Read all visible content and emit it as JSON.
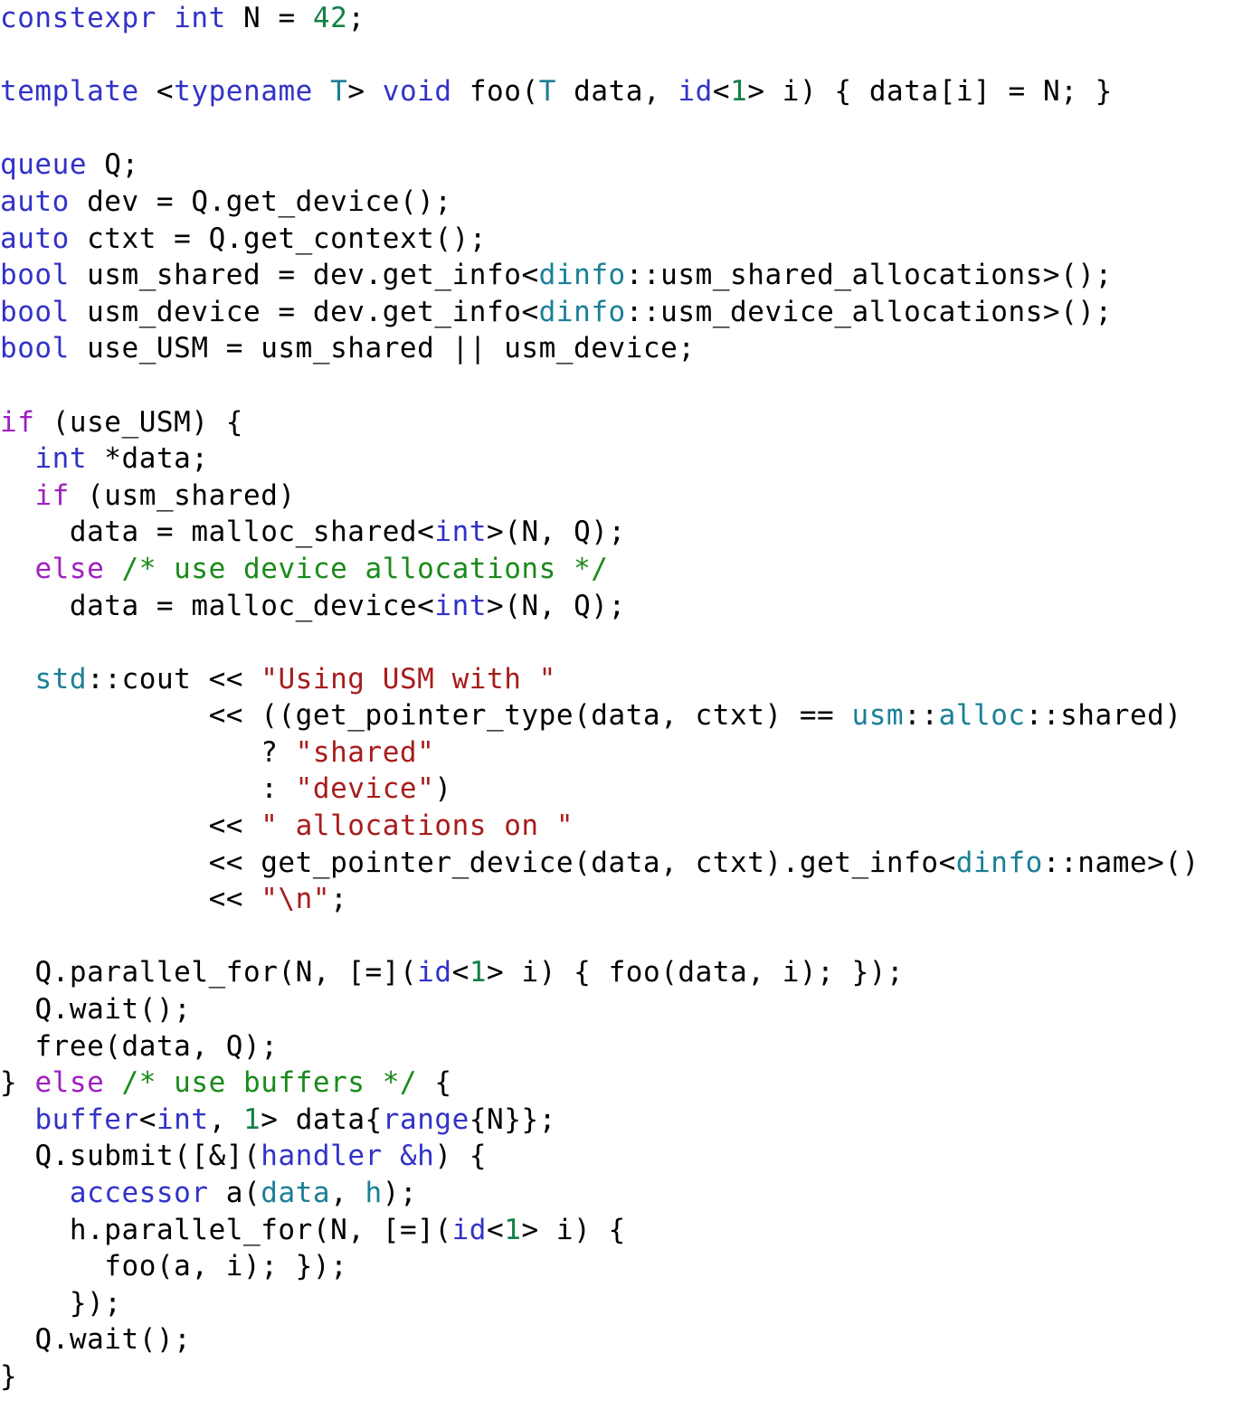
{
  "document": {
    "kind": "source-code-listing",
    "language": "C++ (SYCL)",
    "background_color": "#ffffff",
    "font_size_px": 31,
    "line_height_px": 40.6
  },
  "palette": {
    "plain": "#000000",
    "keyword": "#3232c8",
    "control": "#a020c0",
    "number": "#118044",
    "string": "#a81c1c",
    "comment": "#1a8a1a",
    "function": "#8a6d1a",
    "type": "#1a7f96",
    "variable": "#4b3fa8"
  },
  "code": {
    "plain_text": "constexpr int N = 42;\n\ntemplate <typename T> void foo(T data, id<1> i) { data[i] = N; }\n\nqueue Q;\nauto dev = Q.get_device();\nauto ctxt = Q.get_context();\nbool usm_shared = dev.get_info<dinfo::usm_shared_allocations>();\nbool usm_device = dev.get_info<dinfo::usm_device_allocations>();\nbool use_USM = usm_shared || usm_device;\n\nif (use_USM) {\n  int *data;\n  if (usm_shared)\n    data = malloc_shared<int>(N, Q);\n  else /* use device allocations */\n    data = malloc_device<int>(N, Q);\n\n  std::cout << \"Using USM with \"\n            << ((get_pointer_type(data, ctxt) == usm::alloc::shared)\n               ? \"shared\"\n               : \"device\")\n            << \" allocations on \"\n            << get_pointer_device(data, ctxt).get_info<dinfo::name>()\n            << \"\\n\";\n\n  Q.parallel_for(N, [=](id<1> i) { foo(data, i); });\n  Q.wait();\n  free(data, Q);\n} else /* use buffers */ {\n  buffer<int, 1> data{range{N}};\n  Q.submit([&](handler &h) {\n    accessor a(data, h);\n    h.parallel_for(N, [=](id<1> i) {\n      foo(a, i); });\n    });\n  Q.wait();\n}",
    "lines": [
      {
        "n": 1,
        "tokens": [
          {
            "t": "constexpr",
            "c": "keyword"
          },
          {
            "t": " ",
            "c": "plain"
          },
          {
            "t": "int",
            "c": "keyword"
          },
          {
            "t": " N = ",
            "c": "plain"
          },
          {
            "t": "42",
            "c": "number"
          },
          {
            "t": ";",
            "c": "plain"
          }
        ]
      },
      {
        "n": 2,
        "tokens": []
      },
      {
        "n": 3,
        "tokens": [
          {
            "t": "template",
            "c": "keyword"
          },
          {
            "t": " <",
            "c": "plain"
          },
          {
            "t": "typename",
            "c": "keyword"
          },
          {
            "t": " ",
            "c": "plain"
          },
          {
            "t": "T",
            "c": "type"
          },
          {
            "t": "> ",
            "c": "plain"
          },
          {
            "t": "void",
            "c": "keyword"
          },
          {
            "t": " ",
            "c": "plain"
          },
          {
            "t": "foo",
            "c": "function"
          },
          {
            "t": "(",
            "c": "plain"
          },
          {
            "t": "T",
            "c": "type"
          },
          {
            "t": " ",
            "c": "plain"
          },
          {
            "t": "data",
            "c": "variable"
          },
          {
            "t": ", ",
            "c": "plain"
          },
          {
            "t": "id",
            "c": "keyword"
          },
          {
            "t": "<",
            "c": "plain"
          },
          {
            "t": "1",
            "c": "number"
          },
          {
            "t": "> ",
            "c": "plain"
          },
          {
            "t": "i",
            "c": "variable"
          },
          {
            "t": ") { ",
            "c": "plain"
          },
          {
            "t": "data",
            "c": "variable"
          },
          {
            "t": "[",
            "c": "plain"
          },
          {
            "t": "i",
            "c": "variable"
          },
          {
            "t": "] = N; }",
            "c": "plain"
          }
        ]
      },
      {
        "n": 4,
        "tokens": []
      },
      {
        "n": 5,
        "tokens": [
          {
            "t": "queue",
            "c": "keyword"
          },
          {
            "t": " Q;",
            "c": "plain"
          }
        ]
      },
      {
        "n": 6,
        "tokens": [
          {
            "t": "auto",
            "c": "keyword"
          },
          {
            "t": " dev = ",
            "c": "plain"
          },
          {
            "t": "Q",
            "c": "variable"
          },
          {
            "t": ".",
            "c": "plain"
          },
          {
            "t": "get_device",
            "c": "function"
          },
          {
            "t": "();",
            "c": "plain"
          }
        ]
      },
      {
        "n": 7,
        "tokens": [
          {
            "t": "auto",
            "c": "keyword"
          },
          {
            "t": " ctxt = ",
            "c": "plain"
          },
          {
            "t": "Q",
            "c": "variable"
          },
          {
            "t": ".",
            "c": "plain"
          },
          {
            "t": "get_context",
            "c": "function"
          },
          {
            "t": "();",
            "c": "plain"
          }
        ]
      },
      {
        "n": 8,
        "tokens": [
          {
            "t": "bool",
            "c": "keyword"
          },
          {
            "t": " usm_shared = ",
            "c": "plain"
          },
          {
            "t": "dev",
            "c": "variable"
          },
          {
            "t": ".",
            "c": "plain"
          },
          {
            "t": "get_info",
            "c": "variable"
          },
          {
            "t": "<",
            "c": "plain"
          },
          {
            "t": "dinfo",
            "c": "type"
          },
          {
            "t": "::usm_shared_allocations>();",
            "c": "plain"
          }
        ]
      },
      {
        "n": 9,
        "tokens": [
          {
            "t": "bool",
            "c": "keyword"
          },
          {
            "t": " usm_device = ",
            "c": "plain"
          },
          {
            "t": "dev",
            "c": "variable"
          },
          {
            "t": ".",
            "c": "plain"
          },
          {
            "t": "get_info",
            "c": "variable"
          },
          {
            "t": "<",
            "c": "plain"
          },
          {
            "t": "dinfo",
            "c": "type"
          },
          {
            "t": "::usm_device_allocations>();",
            "c": "plain"
          }
        ]
      },
      {
        "n": 10,
        "tokens": [
          {
            "t": "bool",
            "c": "keyword"
          },
          {
            "t": " use_USM = usm_shared || usm_device;",
            "c": "plain"
          }
        ]
      },
      {
        "n": 11,
        "tokens": []
      },
      {
        "n": 12,
        "tokens": [
          {
            "t": "if",
            "c": "control"
          },
          {
            "t": " (use_USM) {",
            "c": "plain"
          }
        ]
      },
      {
        "n": 13,
        "tokens": [
          {
            "t": "  ",
            "c": "plain"
          },
          {
            "t": "int",
            "c": "keyword"
          },
          {
            "t": " *data;",
            "c": "plain"
          }
        ]
      },
      {
        "n": 14,
        "tokens": [
          {
            "t": "  ",
            "c": "plain"
          },
          {
            "t": "if",
            "c": "control"
          },
          {
            "t": " (usm_shared)",
            "c": "plain"
          }
        ]
      },
      {
        "n": 15,
        "tokens": [
          {
            "t": "    data = ",
            "c": "plain"
          },
          {
            "t": "malloc_shared",
            "c": "function"
          },
          {
            "t": "<",
            "c": "plain"
          },
          {
            "t": "int",
            "c": "keyword"
          },
          {
            "t": ">(N, Q);",
            "c": "plain"
          }
        ]
      },
      {
        "n": 16,
        "tokens": [
          {
            "t": "  ",
            "c": "plain"
          },
          {
            "t": "else",
            "c": "control"
          },
          {
            "t": " ",
            "c": "plain"
          },
          {
            "t": "/* use device allocations */",
            "c": "comment"
          }
        ]
      },
      {
        "n": 17,
        "tokens": [
          {
            "t": "    data = ",
            "c": "plain"
          },
          {
            "t": "malloc_device",
            "c": "function"
          },
          {
            "t": "<",
            "c": "plain"
          },
          {
            "t": "int",
            "c": "keyword"
          },
          {
            "t": ">(N, Q);",
            "c": "plain"
          }
        ]
      },
      {
        "n": 18,
        "tokens": []
      },
      {
        "n": 19,
        "tokens": [
          {
            "t": "  ",
            "c": "plain"
          },
          {
            "t": "std",
            "c": "type"
          },
          {
            "t": "::cout << ",
            "c": "plain"
          },
          {
            "t": "\"Using USM with \"",
            "c": "string"
          }
        ]
      },
      {
        "n": 20,
        "tokens": [
          {
            "t": "            << ((",
            "c": "plain"
          },
          {
            "t": "get_pointer_type",
            "c": "function"
          },
          {
            "t": "(data, ctxt) == ",
            "c": "plain"
          },
          {
            "t": "usm",
            "c": "type"
          },
          {
            "t": "::",
            "c": "plain"
          },
          {
            "t": "alloc",
            "c": "type"
          },
          {
            "t": "::shared)",
            "c": "plain"
          }
        ]
      },
      {
        "n": 21,
        "tokens": [
          {
            "t": "               ? ",
            "c": "plain"
          },
          {
            "t": "\"shared\"",
            "c": "string"
          }
        ]
      },
      {
        "n": 22,
        "tokens": [
          {
            "t": "               : ",
            "c": "plain"
          },
          {
            "t": "\"device\"",
            "c": "string"
          },
          {
            "t": ")",
            "c": "plain"
          }
        ]
      },
      {
        "n": 23,
        "tokens": [
          {
            "t": "            << ",
            "c": "plain"
          },
          {
            "t": "\" allocations on \"",
            "c": "string"
          }
        ]
      },
      {
        "n": 24,
        "tokens": [
          {
            "t": "            << ",
            "c": "plain"
          },
          {
            "t": "get_pointer_device",
            "c": "function"
          },
          {
            "t": "(data, ctxt).",
            "c": "plain"
          },
          {
            "t": "get_info",
            "c": "variable"
          },
          {
            "t": "<",
            "c": "plain"
          },
          {
            "t": "dinfo",
            "c": "type"
          },
          {
            "t": "::name>()",
            "c": "plain"
          }
        ]
      },
      {
        "n": 25,
        "tokens": [
          {
            "t": "            << ",
            "c": "plain"
          },
          {
            "t": "\"\\n\"",
            "c": "string"
          },
          {
            "t": ";",
            "c": "plain"
          }
        ]
      },
      {
        "n": 26,
        "tokens": []
      },
      {
        "n": 27,
        "tokens": [
          {
            "t": "  ",
            "c": "plain"
          },
          {
            "t": "Q",
            "c": "variable"
          },
          {
            "t": ".",
            "c": "plain"
          },
          {
            "t": "parallel_for",
            "c": "function"
          },
          {
            "t": "(N, [=](",
            "c": "plain"
          },
          {
            "t": "id",
            "c": "keyword"
          },
          {
            "t": "<",
            "c": "plain"
          },
          {
            "t": "1",
            "c": "number"
          },
          {
            "t": "> ",
            "c": "plain"
          },
          {
            "t": "i",
            "c": "variable"
          },
          {
            "t": ") { ",
            "c": "plain"
          },
          {
            "t": "foo",
            "c": "function"
          },
          {
            "t": "(data, i); });",
            "c": "plain"
          }
        ]
      },
      {
        "n": 28,
        "tokens": [
          {
            "t": "  ",
            "c": "plain"
          },
          {
            "t": "Q",
            "c": "variable"
          },
          {
            "t": ".",
            "c": "plain"
          },
          {
            "t": "wait",
            "c": "function"
          },
          {
            "t": "();",
            "c": "plain"
          }
        ]
      },
      {
        "n": 29,
        "tokens": [
          {
            "t": "  ",
            "c": "plain"
          },
          {
            "t": "free",
            "c": "function"
          },
          {
            "t": "(data, Q);",
            "c": "plain"
          }
        ]
      },
      {
        "n": 30,
        "tokens": [
          {
            "t": "} ",
            "c": "plain"
          },
          {
            "t": "else",
            "c": "control"
          },
          {
            "t": " ",
            "c": "plain"
          },
          {
            "t": "/* use buffers */",
            "c": "comment"
          },
          {
            "t": " {",
            "c": "plain"
          }
        ]
      },
      {
        "n": 31,
        "tokens": [
          {
            "t": "  ",
            "c": "plain"
          },
          {
            "t": "buffer",
            "c": "keyword"
          },
          {
            "t": "<",
            "c": "plain"
          },
          {
            "t": "int",
            "c": "keyword"
          },
          {
            "t": ", ",
            "c": "plain"
          },
          {
            "t": "1",
            "c": "number"
          },
          {
            "t": "> data{",
            "c": "plain"
          },
          {
            "t": "range",
            "c": "keyword"
          },
          {
            "t": "{N}};",
            "c": "plain"
          }
        ]
      },
      {
        "n": 32,
        "tokens": [
          {
            "t": "  ",
            "c": "plain"
          },
          {
            "t": "Q",
            "c": "variable"
          },
          {
            "t": ".",
            "c": "plain"
          },
          {
            "t": "submit",
            "c": "function"
          },
          {
            "t": "([&](",
            "c": "plain"
          },
          {
            "t": "handler",
            "c": "keyword"
          },
          {
            "t": " ",
            "c": "plain"
          },
          {
            "t": "&h",
            "c": "keyword"
          },
          {
            "t": ") {",
            "c": "plain"
          }
        ]
      },
      {
        "n": 33,
        "tokens": [
          {
            "t": "    ",
            "c": "plain"
          },
          {
            "t": "accessor",
            "c": "keyword"
          },
          {
            "t": " ",
            "c": "plain"
          },
          {
            "t": "a",
            "c": "function"
          },
          {
            "t": "(",
            "c": "plain"
          },
          {
            "t": "data",
            "c": "type"
          },
          {
            "t": ", ",
            "c": "plain"
          },
          {
            "t": "h",
            "c": "type"
          },
          {
            "t": ");",
            "c": "plain"
          }
        ]
      },
      {
        "n": 34,
        "tokens": [
          {
            "t": "    ",
            "c": "plain"
          },
          {
            "t": "h",
            "c": "variable"
          },
          {
            "t": ".",
            "c": "plain"
          },
          {
            "t": "parallel_for",
            "c": "function"
          },
          {
            "t": "(N, [=](",
            "c": "plain"
          },
          {
            "t": "id",
            "c": "keyword"
          },
          {
            "t": "<",
            "c": "plain"
          },
          {
            "t": "1",
            "c": "number"
          },
          {
            "t": "> ",
            "c": "plain"
          },
          {
            "t": "i",
            "c": "variable"
          },
          {
            "t": ") {",
            "c": "plain"
          }
        ]
      },
      {
        "n": 35,
        "tokens": [
          {
            "t": "      ",
            "c": "plain"
          },
          {
            "t": "foo",
            "c": "function"
          },
          {
            "t": "(a, i); });",
            "c": "plain"
          }
        ]
      },
      {
        "n": 36,
        "tokens": [
          {
            "t": "    });",
            "c": "plain"
          }
        ]
      },
      {
        "n": 37,
        "tokens": [
          {
            "t": "  ",
            "c": "plain"
          },
          {
            "t": "Q",
            "c": "variable"
          },
          {
            "t": ".",
            "c": "plain"
          },
          {
            "t": "wait",
            "c": "function"
          },
          {
            "t": "();",
            "c": "plain"
          }
        ]
      },
      {
        "n": 38,
        "tokens": [
          {
            "t": "}",
            "c": "plain"
          }
        ]
      }
    ]
  }
}
